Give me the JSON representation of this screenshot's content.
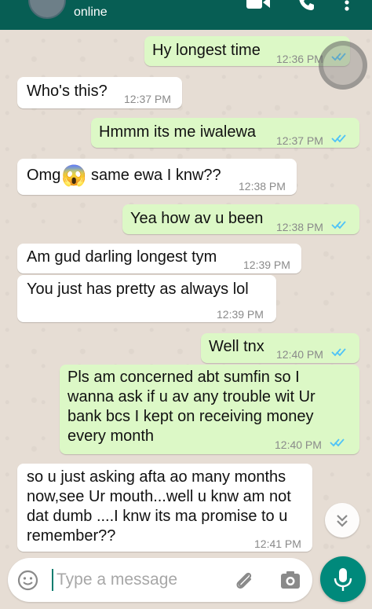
{
  "header": {
    "contact_status": "online"
  },
  "messages": [
    {
      "text": "Hy longest time",
      "time": "12:36 PM",
      "direction": "out"
    },
    {
      "text": "Who's this?",
      "time": "12:37 PM",
      "direction": "in"
    },
    {
      "text": "Hmmm its me iwalewa",
      "time": "12:37 PM",
      "direction": "out"
    },
    {
      "text_before_emoji": "Omg",
      "emoji": "😱",
      "text_after_emoji": "same ewa I knw??",
      "time": "12:38 PM",
      "direction": "in"
    },
    {
      "text": "Yea how av u been",
      "time": "12:38 PM",
      "direction": "out"
    },
    {
      "text": "Am gud darling longest tym",
      "time": "12:39 PM",
      "direction": "in"
    },
    {
      "text": "You just has pretty as  always lol",
      "time": "12:39 PM",
      "direction": "in"
    },
    {
      "text": "Well tnx",
      "time": "12:40 PM",
      "direction": "out"
    },
    {
      "lines": [
        "Pls am concerned abt sumfin so I",
        "wanna ask if u av any trouble wit Ur",
        "bank bcs I kept on receiving money",
        "every month"
      ],
      "time": "12:40 PM",
      "direction": "out"
    },
    {
      "lines": [
        "so u just asking afta ao many months",
        "now,see Ur mouth...well u knw am not",
        "dat dumb ....I knw its ma promise to u",
        "remember??"
      ],
      "time": "12:41 PM",
      "direction": "in"
    }
  ],
  "composer": {
    "placeholder": "Type a message"
  },
  "icons": {
    "video": "video-call-icon",
    "call": "phone-icon",
    "menu": "more-vert-icon",
    "emoji": "emoji-icon",
    "attach": "paperclip-icon",
    "camera": "camera-icon",
    "mic": "mic-icon",
    "scroll": "double-chevron-down-icon"
  },
  "colors": {
    "header": "#075e54",
    "outgoing_bubble": "#dcf8c6",
    "incoming_bubble": "#ffffff",
    "read_ticks": "#4fc3f7",
    "mic_button": "#00897b",
    "chat_background": "#e6ddd4"
  }
}
